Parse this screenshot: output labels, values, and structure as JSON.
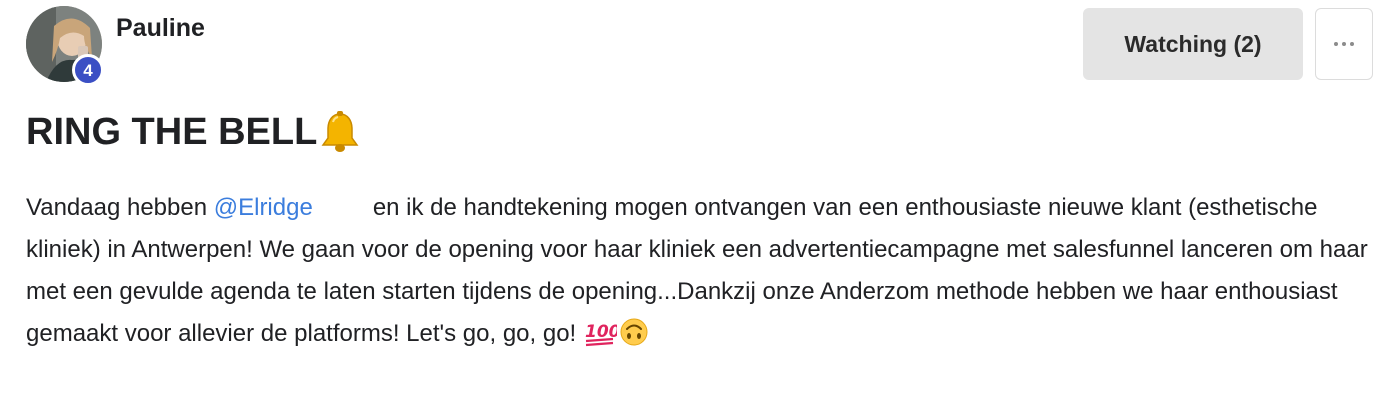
{
  "author": {
    "name": "Pauline",
    "level": "4",
    "avatar_icon": "profile-photo"
  },
  "actions": {
    "watching_label": "Watching (2)",
    "more_icon": "ellipsis-icon"
  },
  "post": {
    "title": "RING THE BELL",
    "title_emoji": "bell-icon",
    "body_before_mention": "Vandaag hebben ",
    "mention": "@Elridge",
    "body_after_mention": "en ik de handtekening mogen ontvangen van een enthousiaste nieuwe klant (esthetische kliniek) in Antwerpen! We gaan voor de opening voor haar kliniek een advertentiecampagne met salesfunnel lanceren om haar met een gevulde agenda te laten starten tijdens de opening...Dankzij onze Anderzom methode hebben we haar enthousiast gemaakt voor allevier de platforms! Let's go, go, go!",
    "trailing_emojis": [
      "hundred-points-icon",
      "upside-down-face-icon"
    ]
  },
  "colors": {
    "mention": "#3b7ddd",
    "level_badge": "#3b4fc4",
    "watch_button_bg": "#e4e4e4"
  }
}
